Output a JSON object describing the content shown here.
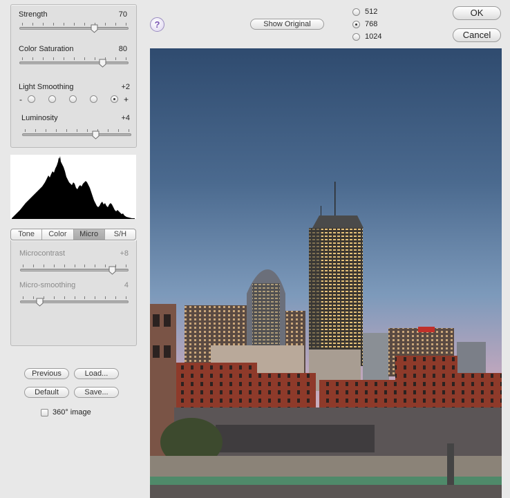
{
  "controls": {
    "strength": {
      "label": "Strength",
      "value": "70",
      "level": 0.7
    },
    "color_saturation": {
      "label": "Color Saturation",
      "value": "80",
      "level": 0.78
    },
    "light_smoothing": {
      "label": "Light Smoothing",
      "value": "+2",
      "minus": "-",
      "plus": "+",
      "options": 5,
      "selected_index": 4
    },
    "luminosity": {
      "label": "Luminosity",
      "value": "+4",
      "level": 0.69
    }
  },
  "tabs": [
    {
      "label": "Tone",
      "active": false
    },
    {
      "label": "Color",
      "active": false
    },
    {
      "label": "Micro",
      "active": true
    },
    {
      "label": "S/H",
      "active": false
    }
  ],
  "micro": {
    "microcontrast": {
      "label": "Microcontrast",
      "value": "+8",
      "level": 0.88
    },
    "micro_smoothing": {
      "label": "Micro-smoothing",
      "value": "4",
      "level": 0.16
    }
  },
  "buttons": {
    "previous": "Previous",
    "load": "Load...",
    "default": "Default",
    "save": "Save...",
    "show_original": "Show Original",
    "ok": "OK",
    "cancel": "Cancel",
    "help": "?"
  },
  "checkbox_360": {
    "label": "360° image",
    "checked": false
  },
  "preview_size": {
    "options": [
      "512",
      "768",
      "1024"
    ],
    "selected": "768"
  },
  "colors": {
    "sky_top": "#2f4b6f",
    "sky_mid": "#6a88aa",
    "sky_low": "#c9a9b8",
    "help_accent": "#7b56b4"
  }
}
